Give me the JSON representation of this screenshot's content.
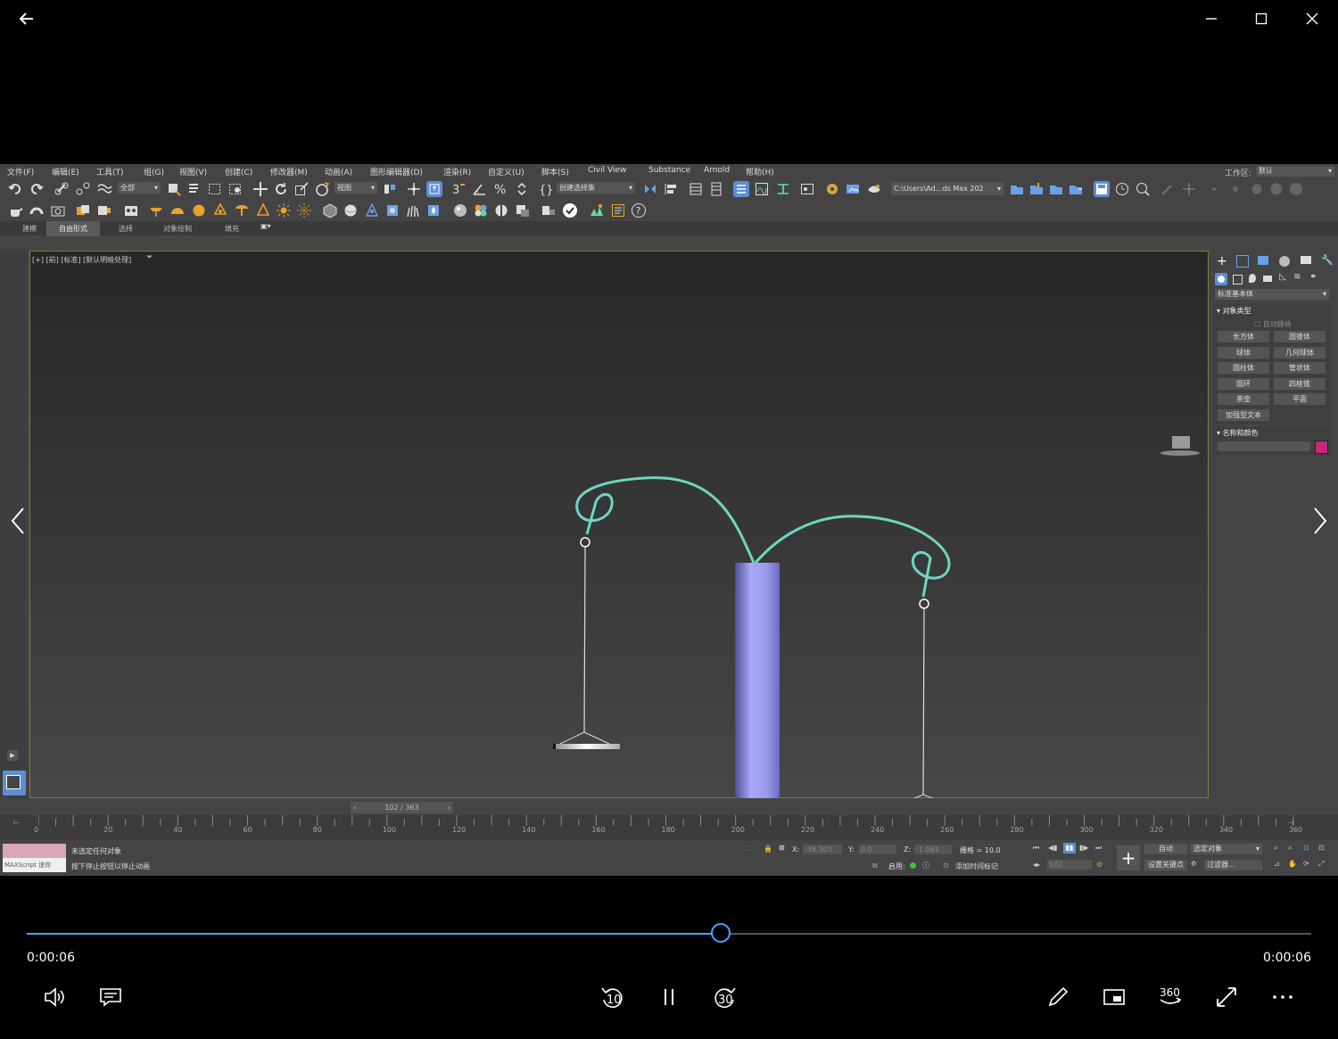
{
  "player": {
    "current_time": "0:00:06",
    "total_time": "0:00:06",
    "progress": 0.54,
    "skip_back": "10",
    "skip_forward": "30",
    "view_360": "360"
  },
  "app": {
    "menu": [
      "文件(F)",
      "编辑(E)",
      "工具(T)",
      "组(G)",
      "视图(V)",
      "创建(C)",
      "修改器(M)",
      "动画(A)",
      "图形编辑器(D)",
      "渲染(R)",
      "自定义(U)",
      "脚本(S)",
      "Civil View",
      "Substance",
      "Arnold",
      "帮助(H)"
    ],
    "workspace_label": "工作区:",
    "workspace_value": "默认",
    "selection_filter": "全部",
    "ref_coord": "视图",
    "named_selection": "创建选择集",
    "project_path": "C:\\Users\\Ad…ds Max 202",
    "ribbon_tabs": [
      "建模",
      "自由形式",
      "选择",
      "对象绘制",
      "填充"
    ],
    "viewport_label": "[+] [前] [标准] [默认明暗处理]",
    "command_panel": {
      "category": "标准基本体",
      "rollout_object_type": "对象类型",
      "auto_grid": "自动栅格",
      "buttons": [
        "长方体",
        "圆锥体",
        "球体",
        "几何球体",
        "圆柱体",
        "管状体",
        "圆环",
        "四棱锥",
        "茶壶",
        "平面",
        "加强型文本"
      ],
      "rollout_name_color": "名称和颜色",
      "color": "#c8287a"
    },
    "frame_counter": "102 / 363",
    "timeline_ticks": [
      "0",
      "20",
      "40",
      "60",
      "80",
      "100",
      "120",
      "140",
      "160",
      "180",
      "200",
      "220",
      "240",
      "260",
      "280",
      "300",
      "320",
      "340",
      "360"
    ],
    "status": {
      "maxscript": "MAXScript 迷你",
      "selection": "未选定任何对象",
      "prompt": "按下停止按钮以停止动画",
      "x_label": "X:",
      "x_value": "-38.303",
      "y_label": "Y:",
      "y_value": "0.0",
      "z_label": "Z:",
      "z_value": "-1.061",
      "grid": "栅格 = 10.0",
      "enable": "启用:",
      "add_time_tag": "添加时间标记",
      "auto": "自动",
      "selected_objects": "选定对象",
      "set_key": "设置关键点",
      "filter": "过滤器...",
      "frame": "102"
    }
  }
}
